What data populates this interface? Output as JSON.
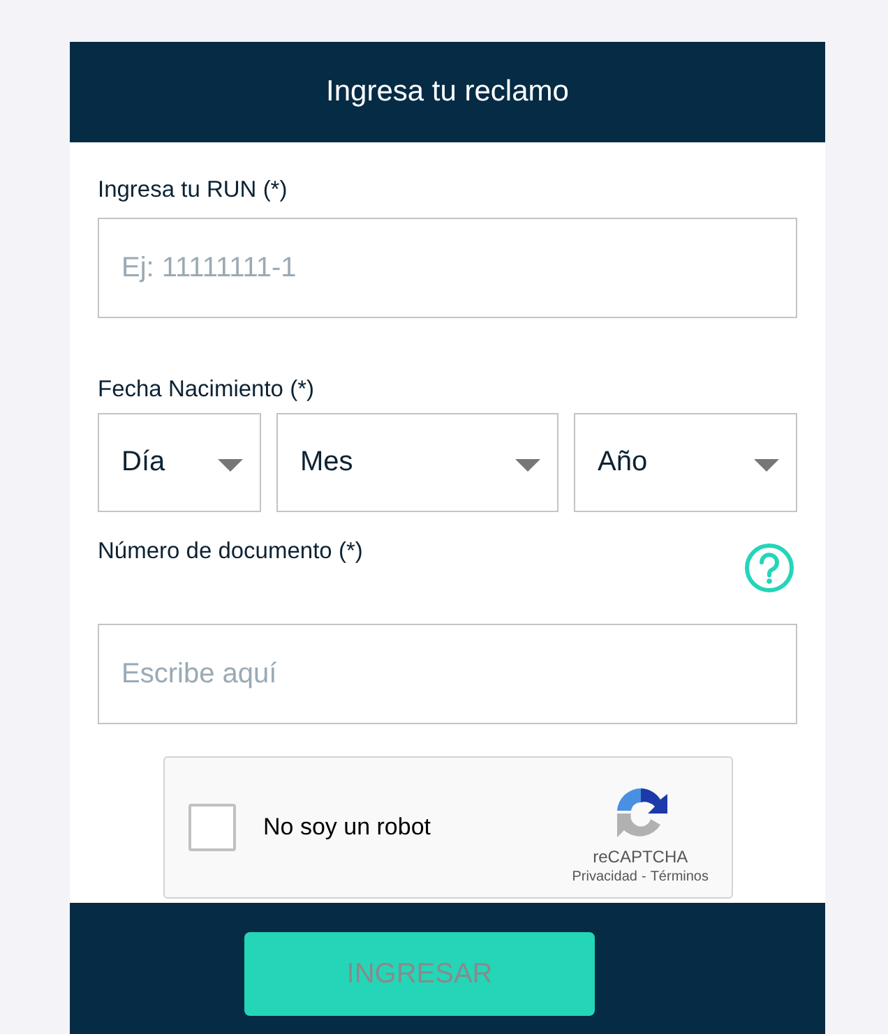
{
  "header": {
    "title": "Ingresa tu reclamo"
  },
  "run_field": {
    "label": "Ingresa tu RUN",
    "required_mark": "(*)",
    "placeholder": "Ej: 11111111-1"
  },
  "birth_date": {
    "label": "Fecha Nacimiento",
    "required_mark": "(*)",
    "selects": [
      {
        "value": "Día",
        "kind": "small"
      },
      {
        "value": "Mes",
        "kind": "wide"
      },
      {
        "value": "Año",
        "kind": "medium"
      }
    ]
  },
  "document_field": {
    "label": "Número de documento",
    "required_mark": "(*)",
    "placeholder": "Escribe aquí"
  },
  "captcha": {
    "label": "No soy un robot",
    "checked": false,
    "brand": "reCAPTCHA",
    "links": [
      "Privacidad",
      "Términos"
    ],
    "separator": "-"
  },
  "submit": {
    "label": "INGRESAR",
    "disabled": true
  }
}
